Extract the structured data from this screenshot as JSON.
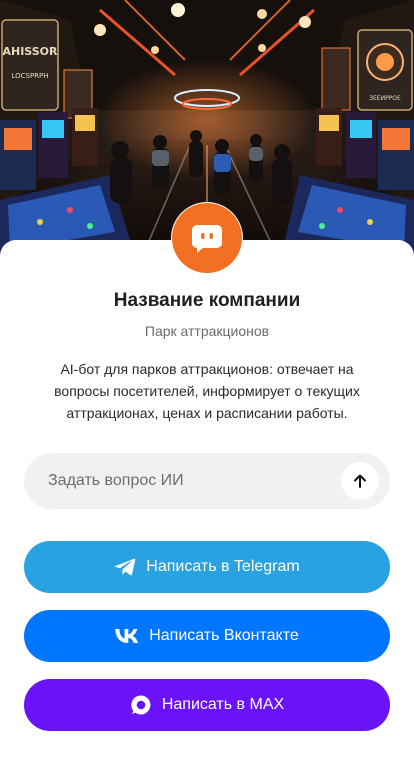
{
  "colors": {
    "accent": "#f36f21",
    "telegram": "#28a2e0",
    "vkontakte": "#0177ff",
    "max": "#6a12f8",
    "input_bg": "#f1f1f1"
  },
  "hero": {
    "image_alt": "",
    "signs": {
      "left_top": "AHISSOR",
      "left_sub": "LOCSPRPH",
      "right_sub": "ЗЕЕИРРОЕ"
    }
  },
  "company": {
    "avatar_icon": "chat-bot-icon",
    "name": "Название компании",
    "type": "Парк аттракционов",
    "description": "AI-бот для парков аттракционов: отвечает на вопросы посетителей, информирует о текущих аттракционах, ценах и расписании работы."
  },
  "ask": {
    "placeholder": "Задать вопрос ИИ",
    "value": "",
    "send_icon": "arrow-up-icon"
  },
  "buttons": {
    "telegram": {
      "label": "Написать в Telegram",
      "icon": "telegram-icon"
    },
    "vkontakte": {
      "label": "Написать Вконтакте",
      "icon": "vk-icon"
    },
    "max": {
      "label": "Написать в MAX",
      "icon": "max-icon"
    }
  }
}
